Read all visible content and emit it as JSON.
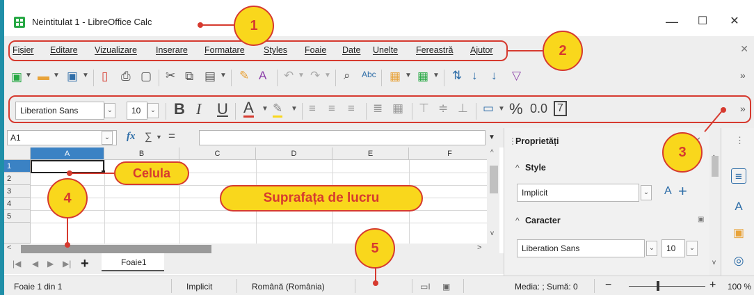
{
  "window": {
    "title": "Neintitulat 1 - LibreOffice Calc",
    "minimize": "—",
    "maximize": "☐",
    "close": "✕"
  },
  "menu": {
    "items": [
      "Fișier",
      "Editare",
      "Vizualizare",
      "Inserare",
      "Formatare",
      "Styles",
      "Foaie",
      "Date",
      "Unelte",
      "Fereastră",
      "Ajutor"
    ],
    "close": "✕"
  },
  "toolbar1": {
    "icons": [
      "new-icon",
      "open-icon",
      "save-icon",
      "export-pdf-icon",
      "print-icon",
      "print-preview-icon",
      "cut-icon",
      "copy-icon",
      "paste-icon",
      "clone-format-icon",
      "clear-format-icon",
      "undo-icon",
      "redo-icon",
      "find-replace-icon",
      "spelling-icon",
      "row-icon",
      "column-icon",
      "sort-icon",
      "sort-ascending-icon",
      "sort-descending-icon",
      "autofilter-icon"
    ],
    "spelling_label": "Abc",
    "overflow": "»"
  },
  "toolbar2": {
    "font_name": "Liberation Sans",
    "font_size": "10",
    "bold": "B",
    "italic": "I",
    "underline": "U",
    "font_color": "A",
    "percent": "%",
    "decimal": "0.0",
    "number_box": "7",
    "overflow": "»"
  },
  "formula_bar": {
    "name_box": "A1",
    "fx": "fx",
    "sum": "∑",
    "equals": "="
  },
  "grid": {
    "columns": [
      "A",
      "B",
      "C",
      "D",
      "E",
      "F"
    ],
    "rows": [
      "1",
      "2",
      "3",
      "4",
      "5"
    ],
    "active_column": "A",
    "active_row": "1"
  },
  "sheets": {
    "tabs": [
      "Foaie1"
    ],
    "add": "+"
  },
  "status": {
    "sheet": "Foaie 1 din 1",
    "style": "Implicit",
    "language": "Română (România)",
    "summary": "Media: ; Sumă: 0",
    "zoom_minus": "−",
    "zoom_plus": "+",
    "zoom": "100 %"
  },
  "sidebar": {
    "title": "Proprietăți",
    "style_section": "Style",
    "style_value": "Implicit",
    "char_section": "Caracter",
    "font_value": "Liberation Sans",
    "size_value": "10",
    "close": "✕",
    "menu": "⋮"
  },
  "annotations": {
    "badge1": "1",
    "badge2": "2",
    "badge3": "3",
    "badge4": "4",
    "badge5": "5",
    "cell_label": "Celula",
    "workspace_label": "Suprafața de lucru"
  },
  "colors": {
    "accent": "#3b82c4",
    "annotation_red": "#d63a2f",
    "annotation_yellow": "#f9d71c",
    "frame_teal": "#1f8fa8"
  }
}
